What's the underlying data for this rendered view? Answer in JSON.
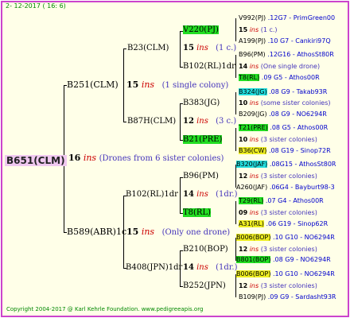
{
  "header": "2- 12-2017 ( 16: 6)",
  "footer": "Copyright 2004-2017 @ Karl Kehrle Foundation.   www.pedigreeapis.org",
  "root": {
    "id": "B651(CLM)",
    "num": "16",
    "ins": "ins",
    "note": "(Drones from 6 sister colonies)"
  },
  "gen2": [
    {
      "id": "B251(CLM)",
      "num": "15",
      "ins": "ins",
      "note": "(1 single colony)"
    },
    {
      "id": "B589(ABR)1c",
      "num": "15",
      "ins": "ins",
      "note": "(Only one drone)"
    }
  ],
  "gen3": [
    {
      "id": "B23(CLM)",
      "num": "15",
      "ins": "ins",
      "note": "(1 c.)"
    },
    {
      "id": "B87H(CLM)",
      "num": "12",
      "ins": "ins",
      "note": "(3 c.)"
    },
    {
      "id": "B102(RL)1dr",
      "num": "14",
      "ins": "ins",
      "note": "(1dr.)"
    },
    {
      "id": "B408(JPN)1dr",
      "num": "14",
      "ins": "ins",
      "note": "(1dr.)"
    }
  ],
  "gen4": [
    {
      "id": "V220(PJ)",
      "num": "15",
      "ins": "ins",
      "note": "(1 c.)"
    },
    {
      "id": "B102(RL)1dr",
      "num": "14",
      "ins": "ins",
      "note": "(One single drone)"
    },
    {
      "id": "B383(JG)",
      "num": "10",
      "ins": "ins",
      "note": "(some sister colonies)"
    },
    {
      "id": "B21(PRE)",
      "num": "10",
      "ins": "ins",
      "note": "(3 sister colonies)"
    },
    {
      "id": "B96(PM)",
      "num": "12",
      "ins": "ins",
      "note": "(3 sister colonies)"
    },
    {
      "id": "T8(RL)",
      "num": "09",
      "ins": "ins",
      "note": "(3 sister colonies)"
    },
    {
      "id": "B210(BOP)",
      "num": "12",
      "ins": "ins",
      "note": "(3 sister colonies)"
    },
    {
      "id": "B252(JPN)",
      "num": "12",
      "ins": "ins",
      "note": "(3 sister colonies)"
    }
  ],
  "gen5": [
    {
      "id": "V992(PJ)",
      "info": ".12G7 - PrimGreen00"
    },
    {
      "id": "A199(PJ)",
      "info": ".10   G7 - Cankiri97Q"
    },
    {
      "id": "B96(PM)",
      "info": ".12G16 - AthosSt80R"
    },
    {
      "id": "T8(RL)",
      "info": ".09       G5 - Athos00R"
    },
    {
      "id": "B324(JG)",
      "info": ".08       G9 - Takab93R"
    },
    {
      "id": "B209(JG)",
      "info": ".08     G9 - NO6294R"
    },
    {
      "id": "T21(PRE)",
      "info": ".08      G5 - Athos00R"
    },
    {
      "id": "B36(CW)",
      "info": ".08    G19 - Sinop72R"
    },
    {
      "id": "B320(JAF)",
      "info": ".08G15 - AthosSt80R"
    },
    {
      "id": "A260(JAF)",
      "info": ".06G4 - Bayburt98-3"
    },
    {
      "id": "T29(RL)",
      "info": ".07       G4 - Athos00R"
    },
    {
      "id": "A31(RL)",
      "info": ".06     G19 - Sinop62R"
    },
    {
      "id": "B006(BOP)",
      "info": ".10   G10 - NO6294R"
    },
    {
      "id": "B801(BOP)",
      "info": ".08       G9 - NO6294R"
    },
    {
      "id": "B006(BOP)",
      "info": ".10   G10 - NO6294R"
    },
    {
      "id": "B109(PJ)",
      "info": ".09 G9 - Sardasht93R"
    }
  ],
  "colors": {
    "frame": "#cc44cc",
    "background": "#ffffe8",
    "green": "#22dd22",
    "cyan": "#22dddd",
    "yellow": "#eeee22",
    "ins": "#cc0000"
  }
}
